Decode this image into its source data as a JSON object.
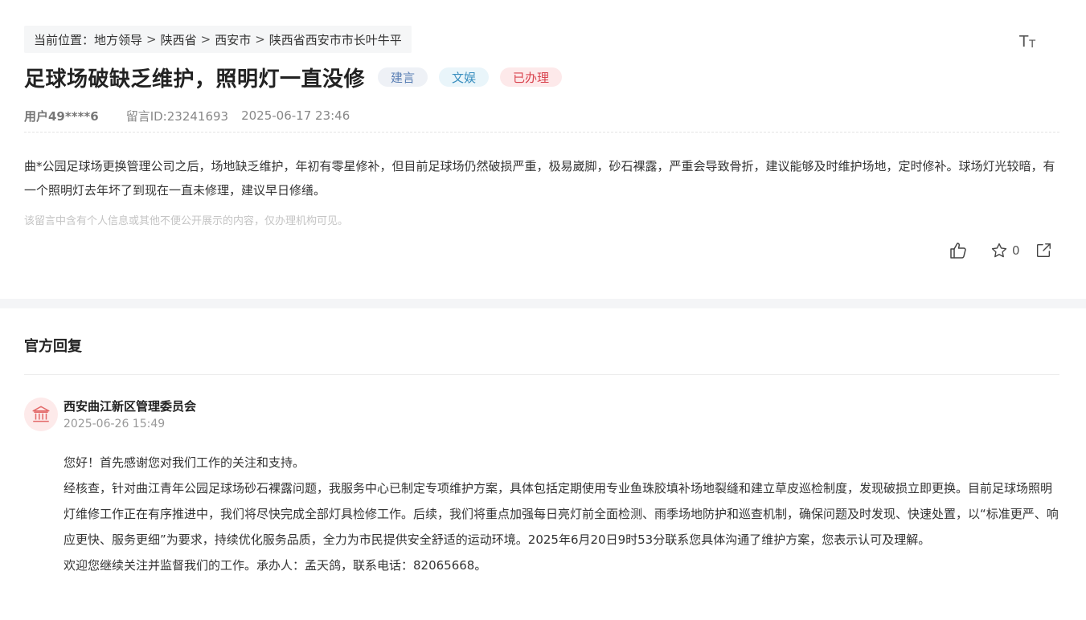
{
  "breadcrumb": {
    "prefix": "当前位置：",
    "items": [
      "地方领导",
      "陕西省",
      "西安市",
      "陕西省西安市市长叶牛平"
    ],
    "separator": ">"
  },
  "font_toggle": {
    "icon": "font-size-icon",
    "big": "T",
    "small": "T"
  },
  "post": {
    "title": "足球场破缺乏维护，照明灯一直没修",
    "tags": {
      "type": "建言",
      "category": "文娱",
      "status": "已办理"
    },
    "user": "用户49****6",
    "message_id": "留言ID:23241693",
    "datetime": "2025-06-17 23:46",
    "content": "曲*公园足球场更换管理公司之后，场地缺乏维护，年初有零星修补，但目前足球场仍然破损严重，极易崴脚，砂石裸露，严重会导致骨折，建议能够及时维护场地，定时修补。球场灯光较暗，有一个照明灯去年坏了到现在一直未修理，建议早日修缮。",
    "privacy_note": "该留言中含有个人信息或其他不便公开展示的内容，仅办理机构可见。",
    "actions": {
      "like_icon": "thumbs-up-icon",
      "favorite_icon": "star-icon",
      "favorite_count": "0",
      "share_icon": "share-icon"
    }
  },
  "reply": {
    "heading": "官方回复",
    "org": {
      "name": "西安曲江新区管理委员会",
      "time": "2025-06-26 15:49",
      "icon": "government-building-icon"
    },
    "paragraphs": [
      "您好！首先感谢您对我们工作的关注和支持。",
      "经核查，针对曲江青年公园足球场砂石裸露问题，我服务中心已制定专项维护方案，具体包括定期使用专业鱼珠胶填补场地裂缝和建立草皮巡检制度，发现破损立即更换。目前足球场照明灯维修工作正在有序推进中，我们将尽快完成全部灯具检修工作。后续，我们将重点加强每日亮灯前全面检测、雨季场地防护和巡查机制，确保问题及时发现、快速处置，以“标准更严、响应更快、服务更细”为要求，持续优化服务品质，全力为市民提供安全舒适的运动环境。2025年6月20日9时53分联系您具体沟通了维护方案，您表示认可及理解。",
      "欢迎您继续关注并监督我们的工作。承办人：孟天鸽，联系电话：82065668。"
    ]
  },
  "colors": {
    "tag_type_text": "#5a7fb4",
    "tag_category_text": "#3a8fbf",
    "tag_status_text": "#d9434e",
    "avatar_bg": "#fdeaea",
    "avatar_icon": "#e36a6a"
  }
}
